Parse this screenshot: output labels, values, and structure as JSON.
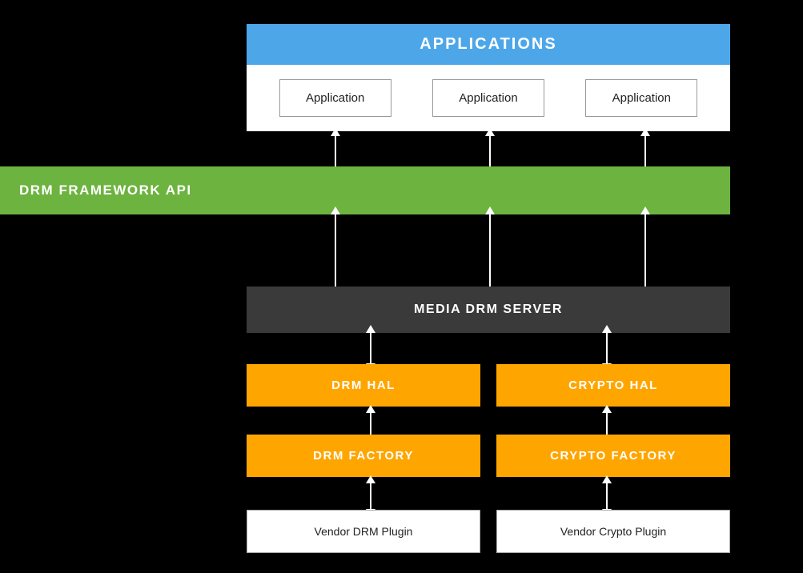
{
  "applications": {
    "header": "APPLICATIONS",
    "boxes": [
      "Application",
      "Application",
      "Application"
    ]
  },
  "drm_api": {
    "label": "DRM FRAMEWORK API"
  },
  "media_drm": {
    "label": "MEDIA DRM SERVER"
  },
  "hal_row": {
    "drm": "DRM HAL",
    "crypto": "CRYPTO HAL"
  },
  "factory_row": {
    "drm": "DRM FACTORY",
    "crypto": "CRYPTO FACTORY"
  },
  "vendor_row": {
    "drm": "Vendor DRM Plugin",
    "crypto": "Vendor Crypto Plugin"
  },
  "colors": {
    "blue": "#4DA6E8",
    "green": "#6DB33F",
    "dark_gray": "#3a3a3a",
    "orange": "#FFA500",
    "white": "#ffffff",
    "black": "#000000"
  }
}
